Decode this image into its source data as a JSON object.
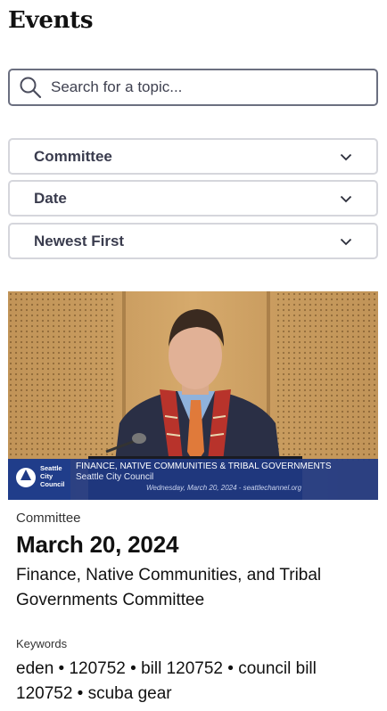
{
  "page": {
    "title": "Events"
  },
  "search": {
    "placeholder": "Search for a topic..."
  },
  "filters": [
    {
      "label": "Committee"
    },
    {
      "label": "Date"
    },
    {
      "label": "Newest First"
    }
  ],
  "event": {
    "thumbnail": {
      "logo_lines": [
        "Seattle",
        "City",
        "Council"
      ],
      "banner_title": "FINANCE, NATIVE COMMUNITIES & TRIBAL GOVERNMENTS",
      "banner_subtitle": "Seattle City Council",
      "banner_dateline": "Wednesday, March 20, 2024 - seattlechannel.org"
    },
    "type": "Committee",
    "date": "March 20, 2024",
    "name": "Finance, Native Communities, and Tribal Governments Committee",
    "keywords_label": "Keywords",
    "keywords": "eden • 120752 • bill 120752 • council bill 120752 • scuba gear"
  },
  "colors": {
    "input_border": "#6b6f80",
    "filter_border": "#d5d6dc",
    "filter_text": "#3a3c4e",
    "banner_blue": "#1f3a86"
  }
}
